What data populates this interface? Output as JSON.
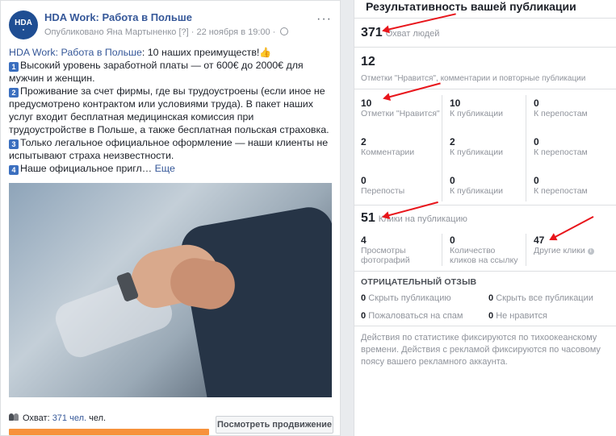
{
  "post": {
    "page_name": "HDA Work: Работа в Польше",
    "avatar_text": "HDA",
    "meta": "Опубликовано Яна Мартыненко [?] · 22 ноября в 19:00 ·",
    "text_link": "HDA Work: Работа в Польше",
    "text_intro": ": 10 наших преимуществ!",
    "items": [
      {
        "num": "1",
        "text": "Высокий уровень заработной платы — от 600€ до 2000€ для мужчин и женщин."
      },
      {
        "num": "2",
        "text": "Проживание за счет фирмы, где вы трудоустроены (если иное не предусмотрено контрактом или условиями труда). В пакет наших услуг входит бесплатная медицинская комиссия при трудоустройстве в Польше, а также бесплатная польская страховка."
      },
      {
        "num": "3",
        "text": "Только легальное официальное оформление — наши клиенты не испытывают страха неизвестности."
      },
      {
        "num": "4",
        "text": "Наше официальное пригл…"
      }
    ],
    "more_link": "Еще",
    "reach_label": "Охват:",
    "reach_value": "371 чел.",
    "reach_unit": "чел.",
    "promote_button": "Посмотреть продвижение",
    "reach_bar_fraction": 0.62
  },
  "stats": {
    "title": "Результативность вашей публикации",
    "reach": {
      "value": "371",
      "label": "Охват людей"
    },
    "engagement": {
      "value": "12",
      "label": "Отметки \"Нравится\", комментарии и повторные публикации"
    },
    "rows": [
      [
        {
          "value": "10",
          "label": "Отметки \"Нравится\""
        },
        {
          "value": "10",
          "label": "К публикации"
        },
        {
          "value": "0",
          "label": "К перепостам"
        }
      ],
      [
        {
          "value": "2",
          "label": "Комментарии"
        },
        {
          "value": "2",
          "label": "К публикации"
        },
        {
          "value": "0",
          "label": "К перепостам"
        }
      ],
      [
        {
          "value": "0",
          "label": "Перепосты"
        },
        {
          "value": "0",
          "label": "К публикации"
        },
        {
          "value": "0",
          "label": "К перепостам"
        }
      ]
    ],
    "clicks": {
      "value": "51",
      "label": "Клики на публикацию"
    },
    "click_rows": [
      {
        "value": "4",
        "label": "Просмотры фотографий"
      },
      {
        "value": "0",
        "label": "Количество кликов на ссылку"
      },
      {
        "value": "47",
        "label": "Другие клики"
      }
    ],
    "negative_title": "ОТРИЦАТЕЛЬНЫЙ ОТЗЫВ",
    "negative": [
      {
        "value": "0",
        "label": "Скрыть публикацию"
      },
      {
        "value": "0",
        "label": "Скрыть все публикации"
      },
      {
        "value": "0",
        "label": "Пожаловаться на спам"
      },
      {
        "value": "0",
        "label": "Не нравится"
      }
    ],
    "footnote": "Действия по статистике фиксируются по тихоокеанскому времени. Действия с рекламой фиксируются по часовому поясу вашего рекламного аккаунта."
  },
  "colors": {
    "accent": "#365899",
    "reach_bar": "#f7923b",
    "arrow": "#e8151b"
  }
}
